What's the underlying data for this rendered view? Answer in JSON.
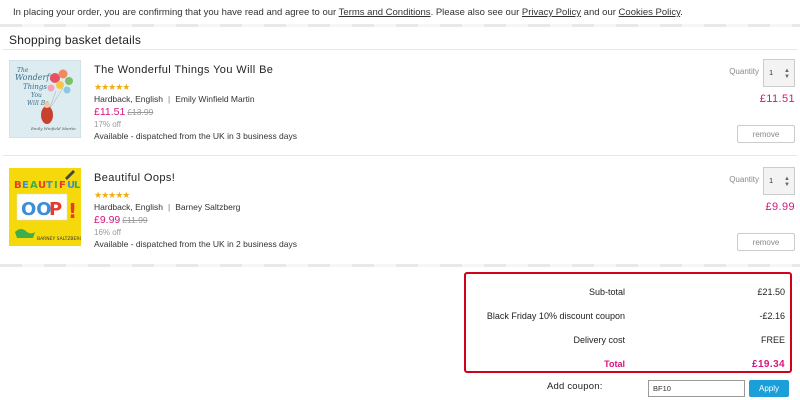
{
  "notice": {
    "prefix": "In placing your order, you are confirming that you have read and agree to our ",
    "terms_link": "Terms and Conditions",
    "middle": ". Please also see our ",
    "privacy_link": "Privacy Policy",
    "and": " and our ",
    "cookies_link": "Cookies Policy",
    "suffix": "."
  },
  "basket": {
    "title": "Shopping basket details",
    "items": [
      {
        "title": "The Wonderful Things You Will Be",
        "stars": "★★★★★",
        "rating": 4.5,
        "format": "Hardback, English",
        "separator": "|",
        "author": "Emily Winfield Martin",
        "price": "£11.51",
        "was_price": "£13.99",
        "discount": "17% off",
        "availability": "Available - dispatched from the UK in 3 business days",
        "quantity_label": "Quantity",
        "quantity": "1",
        "line_total": "£11.51",
        "remove_label": "remove",
        "cover_colors": [
          "#d7e9ef",
          "#f08a5d",
          "#e94f64",
          "#7fbf6a",
          "#f3c64a"
        ]
      },
      {
        "title": "Beautiful Oops!",
        "stars": "★★★★★",
        "rating": 4.5,
        "format": "Hardback, English",
        "separator": "|",
        "author": "Barney Saltzberg",
        "price": "£9.99",
        "was_price": "£11.99",
        "discount": "16% off",
        "availability": "Available - dispatched from the UK in 2 business days",
        "quantity_label": "Quantity",
        "quantity": "1",
        "line_total": "£9.99",
        "remove_label": "remove",
        "cover_colors": [
          "#f5d90a",
          "#3a8fd6",
          "#e8392f",
          "#3fae49",
          "#ffffff"
        ]
      }
    ]
  },
  "summary": {
    "subtotal_label": "Sub-total",
    "subtotal_value": "£21.50",
    "coupon_label": "Black Friday 10% discount coupon",
    "coupon_value": "-£2.16",
    "delivery_label": "Delivery cost",
    "delivery_value": "FREE",
    "total_label": "Total",
    "total_value": "£19.34",
    "highlight_color": "#d0021b",
    "accent_color": "#d6157f"
  },
  "coupon": {
    "label": "Add coupon:",
    "value": "BF10",
    "apply_label": "Apply",
    "apply_color": "#1a9fd9"
  }
}
